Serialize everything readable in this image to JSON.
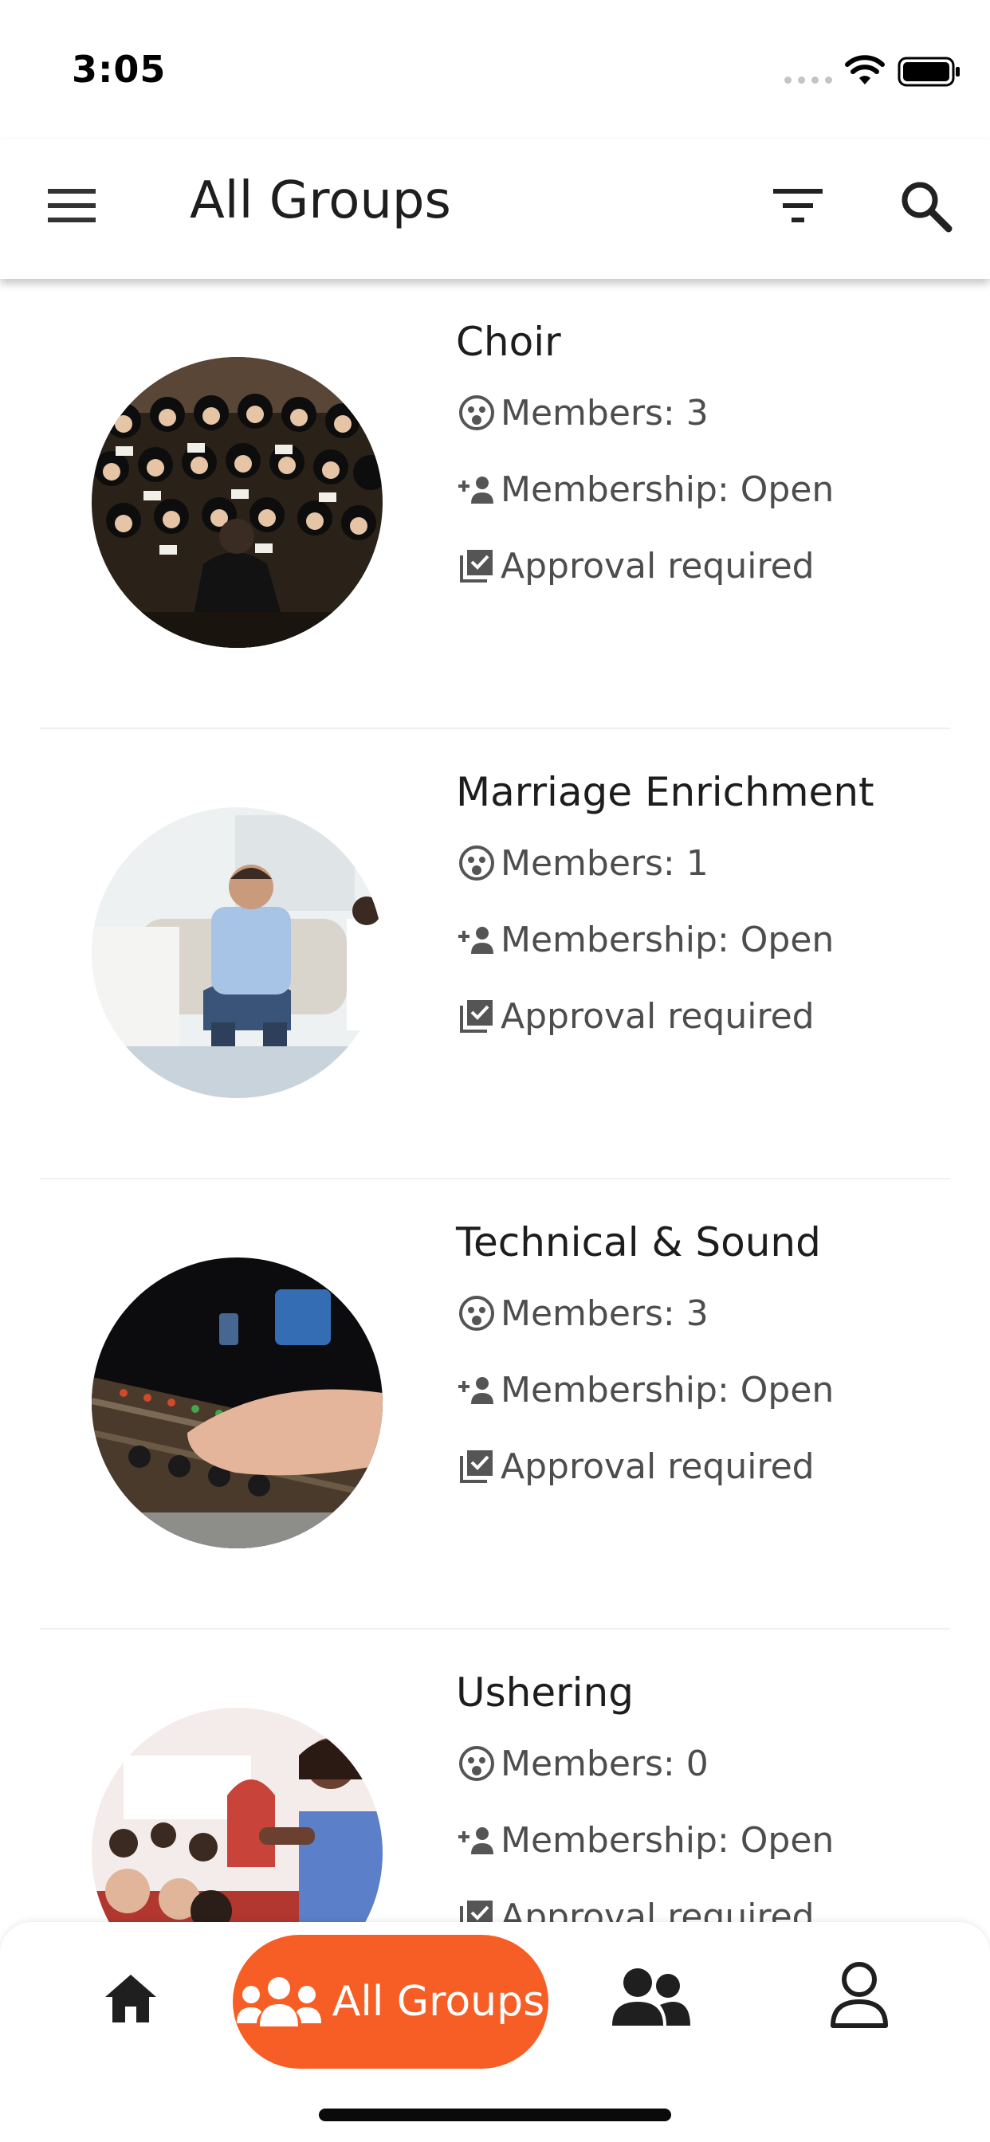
{
  "status_bar": {
    "time": "3:05"
  },
  "header": {
    "title": "All Groups"
  },
  "groups": [
    {
      "name": "Choir",
      "members_label": "Members:",
      "members_value": "3",
      "membership_label": "Membership:",
      "membership_value": "Open",
      "approval": "Approval required",
      "image": "choir-photo"
    },
    {
      "name": "Marriage Enrichment",
      "members_label": "Members:",
      "members_value": "1",
      "membership_label": "Membership:",
      "membership_value": "Open",
      "approval": "Approval required",
      "image": "counseling-photo"
    },
    {
      "name": "Technical & Sound",
      "members_label": "Members:",
      "members_value": "3",
      "membership_label": "Membership:",
      "membership_value": "Open",
      "approval": "Approval required",
      "image": "mixing-console-photo"
    },
    {
      "name": "Ushering",
      "members_label": "Members:",
      "members_value": "0",
      "membership_label": "Membership:",
      "membership_value": "Open",
      "approval": "Approval required",
      "image": "usher-photo"
    }
  ],
  "bottom_nav": {
    "active_label": "All Groups",
    "items": [
      "home-icon",
      "all-groups-icon",
      "my-groups-icon",
      "profile-icon"
    ]
  },
  "colors": {
    "accent": "#f75e25",
    "text": "#1e1e1e",
    "secondary_text": "#4d4d4d"
  }
}
